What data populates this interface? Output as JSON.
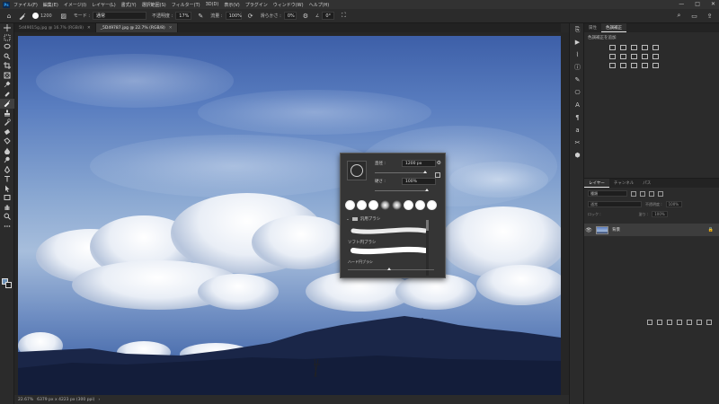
{
  "menubar": {
    "logo": "Ps",
    "items": [
      "ファイル(F)",
      "編集(E)",
      "イメージ(I)",
      "レイヤー(L)",
      "書式(Y)",
      "選択範囲(S)",
      "フィルター(T)",
      "3D(D)",
      "表示(V)",
      "プラグイン",
      "ウィンドウ(W)",
      "ヘルプ(H)"
    ],
    "window_controls": [
      "—",
      "□",
      "✕"
    ]
  },
  "options": {
    "brush_size": "1200",
    "mode_label": "モード :",
    "mode_value": "通常",
    "opacity_label": "不透明度 :",
    "opacity_value": "17%",
    "flow_label": "流量 :",
    "flow_value": "100%",
    "smoothing_label": "滑らかさ :",
    "smoothing_value": "0%",
    "angle_value": "0°"
  },
  "tabs": [
    {
      "label": "5d49015g.jpg @ 16.7% (RGB/8)",
      "active": false
    },
    {
      "label": "_5D49787.jpg @ 22.7% (RGB/8)",
      "active": true
    }
  ],
  "status": {
    "zoom": "22.67%",
    "doc_info": "6379 px x 4223 px (300 ppi)"
  },
  "right_panel": {
    "tabs": [
      "属性",
      "色調補正"
    ],
    "active_tab": "色調補正",
    "adj_title": "色調補正を追加"
  },
  "layers_panel": {
    "tabs": [
      "レイヤー",
      "チャンネル",
      "パス"
    ],
    "filter_label": "種類",
    "blend_mode": "通常",
    "opacity_label": "不透明度 :",
    "opacity_value": "100%",
    "lock_label": "ロック :",
    "fill_label": "塗り :",
    "fill_value": "100%",
    "layer_name": "背景"
  },
  "brush_popup": {
    "size_label": "直径 :",
    "size_value": "1200 px",
    "hardness_label": "硬さ :",
    "hardness_value": "100%",
    "folder_label": "汎用ブラシ",
    "brush_names": [
      "ソフト円ブラシ",
      "ハード円ブラシ"
    ]
  },
  "colors": {
    "accent": "#31a8ff",
    "foreground": "#6b8fb4",
    "background": "#222222",
    "ui_dark": "#2b2b2b"
  }
}
